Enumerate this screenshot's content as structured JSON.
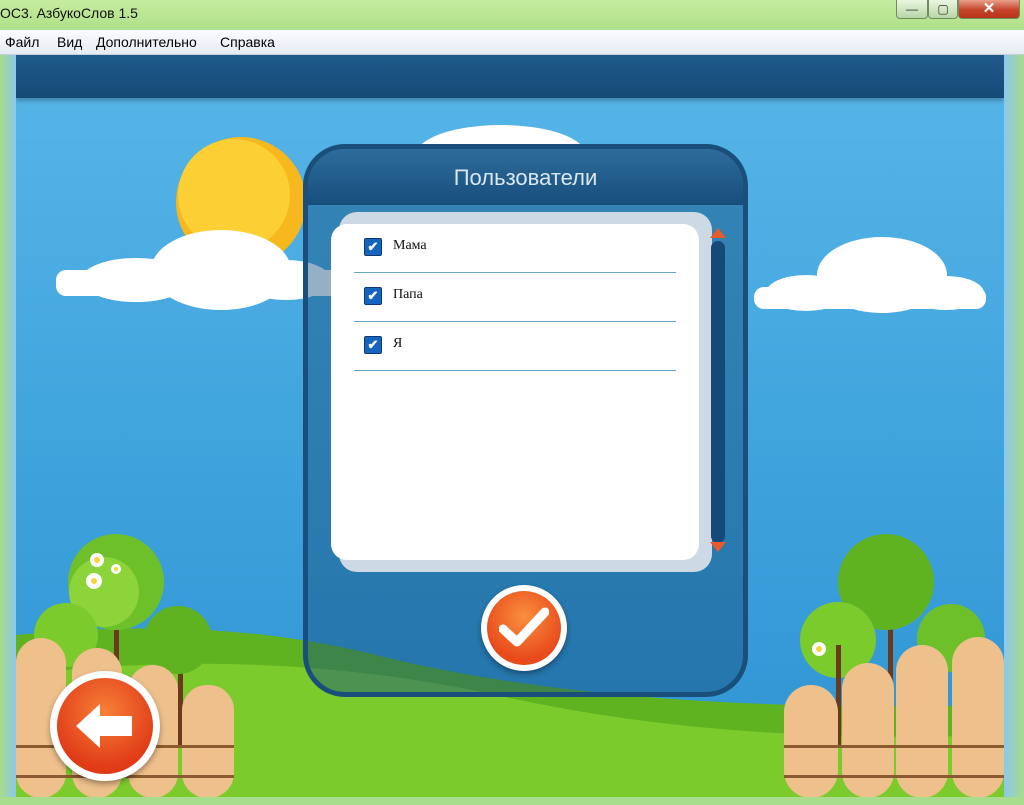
{
  "window": {
    "title": "ОС3. АзбукоСлов 1.5",
    "controls": {
      "minimize": "—",
      "maximize": "▢",
      "close": "✕"
    }
  },
  "menu": {
    "items": [
      "Файл",
      "Вид",
      "Дополнительно",
      "Справка"
    ]
  },
  "dialog": {
    "title": "Пользователи",
    "users": [
      {
        "name": "Мама",
        "checked": true
      },
      {
        "name": "Папа",
        "checked": true
      },
      {
        "name": "Я",
        "checked": true
      }
    ],
    "check_mark": "✔"
  },
  "icons": {
    "confirm": "checkmark-icon",
    "back": "arrow-left-icon",
    "scroll_up": "scroll-up-arrow-icon",
    "scroll_down": "scroll-down-arrow-icon"
  },
  "colors": {
    "sky": "#3ea3dc",
    "dark_blue": "#1b4f7b",
    "accent_orange": "#e84a1b",
    "checkbox": "#1565c0"
  }
}
